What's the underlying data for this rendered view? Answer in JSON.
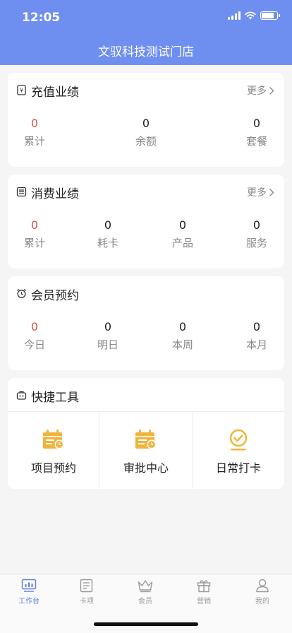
{
  "status_bar": {
    "time": "12:05"
  },
  "header": {
    "store_name": "文驭科技测试门店"
  },
  "recharge": {
    "title": "充值业绩",
    "more": "更多",
    "stats": [
      {
        "value": "0",
        "label": "累计"
      },
      {
        "value": "0",
        "label": "余额"
      },
      {
        "value": "0",
        "label": "套餐"
      }
    ]
  },
  "consumption": {
    "title": "消费业绩",
    "more": "更多",
    "stats": [
      {
        "value": "0",
        "label": "累计"
      },
      {
        "value": "0",
        "label": "耗卡"
      },
      {
        "value": "0",
        "label": "产品"
      },
      {
        "value": "0",
        "label": "服务"
      }
    ]
  },
  "appointments": {
    "title": "会员预约",
    "stats": [
      {
        "value": "0",
        "label": "今日"
      },
      {
        "value": "0",
        "label": "明日"
      },
      {
        "value": "0",
        "label": "本周"
      },
      {
        "value": "0",
        "label": "本月"
      }
    ]
  },
  "tools": {
    "title": "快捷工具",
    "items": [
      {
        "label": "项目预约",
        "icon": "calendar-clock-icon"
      },
      {
        "label": "审批中心",
        "icon": "calendar-clock-icon"
      },
      {
        "label": "日常打卡",
        "icon": "checkin-badge-icon"
      }
    ]
  },
  "tabbar": {
    "items": [
      {
        "label": "工作台",
        "icon": "dashboard-icon",
        "active": true
      },
      {
        "label": "卡项",
        "icon": "card-list-icon",
        "active": false
      },
      {
        "label": "会员",
        "icon": "crown-icon",
        "active": false
      },
      {
        "label": "营销",
        "icon": "gift-icon",
        "active": false
      },
      {
        "label": "我的",
        "icon": "profile-icon",
        "active": false
      }
    ]
  },
  "colors": {
    "header": "#6f8ff0",
    "accent_red": "#d9534f",
    "tool_gold": "#f0b43c",
    "tab_active": "#5a7fd8"
  }
}
